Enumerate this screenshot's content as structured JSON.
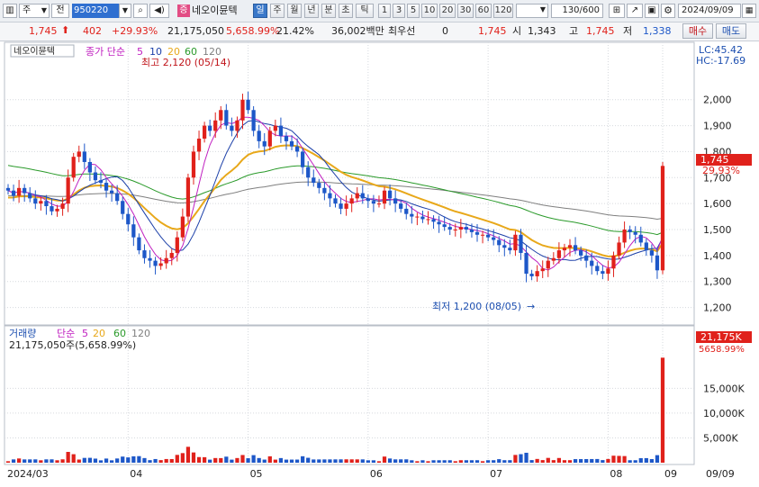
{
  "toolbar": {
    "type_label": "주",
    "prev_label": "전",
    "code_value": "950220",
    "name_tag": "증",
    "stock_name": "네오이뮨텍",
    "periods": [
      "일",
      "주",
      "월",
      "년",
      "분",
      "초",
      "틱"
    ],
    "selected_period": "일",
    "minute_options": [
      "1",
      "3",
      "5",
      "10",
      "20",
      "30",
      "60",
      "120"
    ],
    "count": "130/600",
    "date": "2024/09/09"
  },
  "quote": {
    "price": "1,745",
    "change": "402",
    "change_pct": "+29.93%",
    "volume": "21,175,050",
    "volume_pct": "5,658.99%",
    "turnover": "21.42%",
    "trade_value": "36,002백만",
    "orderbook_label": "최우선",
    "orderbook_qty": "0",
    "ask": "1,745",
    "open_label": "시",
    "open": "1,343",
    "high_label": "고",
    "high": "1,745",
    "low_label": "저",
    "low": "1,338",
    "buy_label": "매수",
    "sell_label": "매도"
  },
  "colors": {
    "up": "#e0211b",
    "down": "#1d57c8",
    "ma5": "#c020c0",
    "ma10": "#1b3fa8",
    "ma20": "#e8a81a",
    "ma60": "#2a9a2a",
    "ma120": "#7f7f7f"
  },
  "chart_data": {
    "type": "candlestick",
    "title": "네오이뮨텍",
    "legend": {
      "label": "종가 단순",
      "periods": [
        "5",
        "10",
        "20",
        "60",
        "120"
      ]
    },
    "lc_text": "LC:45.42",
    "hc_text": "HC:-17.69",
    "annotation_high": "최고 2,120 (05/14)",
    "annotation_low": "최저 1,200 (08/05)",
    "ylim": [
      1150,
      2200
    ],
    "y_ticks": [
      "2,000",
      "1,900",
      "1,800",
      "1,700",
      "1,600",
      "1,500",
      "1,400",
      "1,300",
      "1,200"
    ],
    "last_price_label": "1,745",
    "last_pct_label": "29.93%",
    "x_ticks": [
      "2024/03",
      "04",
      "05",
      "06",
      "07",
      "08",
      "09",
      "09/09"
    ],
    "ma_endpoints": {
      "ma20_start": 1620,
      "ma60_start": 1750,
      "ma120_end": 1590
    },
    "volume": {
      "legend_label": "거래량",
      "legend_ma": "단순",
      "ma_periods": [
        "5",
        "20",
        "60",
        "120"
      ],
      "info": "21,175,050주(5,658.99%)",
      "y_ticks": [
        "15,000K",
        "10,000K",
        "5,000K"
      ],
      "last_label": "21,175K",
      "last_pct": "5658.99%",
      "max": 21175
    },
    "closes": [
      1650,
      1630,
      1660,
      1640,
      1620,
      1600,
      1610,
      1590,
      1570,
      1580,
      1600,
      1700,
      1780,
      1800,
      1760,
      1720,
      1690,
      1680,
      1650,
      1640,
      1610,
      1560,
      1520,
      1470,
      1420,
      1390,
      1380,
      1360,
      1370,
      1390,
      1410,
      1470,
      1550,
      1700,
      1800,
      1850,
      1900,
      1880,
      1920,
      1960,
      1900,
      1880,
      1920,
      2000,
      1960,
      1880,
      1840,
      1820,
      1880,
      1900,
      1860,
      1840,
      1820,
      1800,
      1740,
      1700,
      1680,
      1660,
      1640,
      1620,
      1600,
      1580,
      1600,
      1620,
      1640,
      1620,
      1610,
      1600,
      1600,
      1650,
      1620,
      1600,
      1580,
      1560,
      1550,
      1550,
      1540,
      1540,
      1530,
      1520,
      1510,
      1500,
      1500,
      1510,
      1500,
      1490,
      1480,
      1480,
      1470,
      1460,
      1440,
      1430,
      1420,
      1480,
      1410,
      1330,
      1320,
      1340,
      1350,
      1380,
      1390,
      1420,
      1430,
      1440,
      1420,
      1400,
      1380,
      1360,
      1340,
      1330,
      1350,
      1400,
      1450,
      1500,
      1490,
      1480,
      1450,
      1420,
      1400,
      1343,
      1745
    ]
  }
}
